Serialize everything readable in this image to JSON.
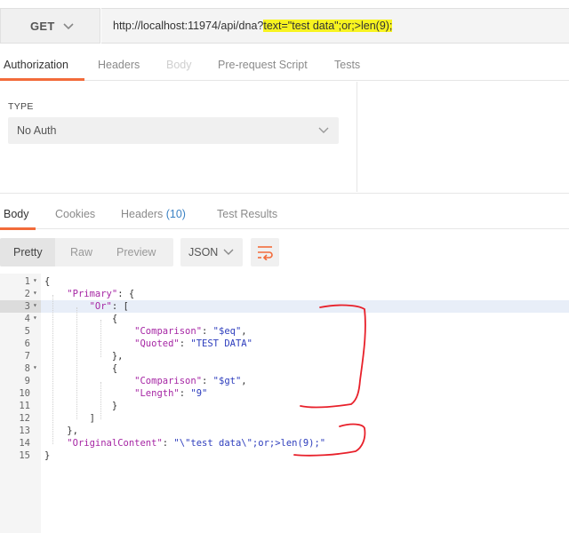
{
  "request": {
    "method": "GET",
    "url_prefix": "http://localhost:11974/api/dna?",
    "url_highlight": "text=\"test data\";or;>len(9);"
  },
  "request_tabs": [
    {
      "label": "Authorization"
    },
    {
      "label": "Headers"
    },
    {
      "label": "Body"
    },
    {
      "label": "Pre-request Script"
    },
    {
      "label": "Tests"
    }
  ],
  "auth": {
    "type_label": "TYPE",
    "selected": "No Auth"
  },
  "response_tabs": [
    {
      "label": "Body"
    },
    {
      "label": "Cookies"
    },
    {
      "label": "Headers",
      "badge": "(10)"
    },
    {
      "label": "Test Results"
    }
  ],
  "response_toolbar": {
    "views": [
      "Pretty",
      "Raw",
      "Preview"
    ],
    "format": "JSON"
  },
  "code_lines": [
    {
      "n": "1",
      "fold": "▾",
      "code": "{"
    },
    {
      "n": "2",
      "fold": "▾",
      "code": "    \"Primary\": {"
    },
    {
      "n": "3",
      "fold": "▾",
      "code": "        \"Or\": ["
    },
    {
      "n": "4",
      "fold": "▾",
      "code": "            {"
    },
    {
      "n": "5",
      "fold": "",
      "code": "                \"Comparison\": \"$eq\","
    },
    {
      "n": "6",
      "fold": "",
      "code": "                \"Quoted\": \"TEST DATA\""
    },
    {
      "n": "7",
      "fold": "",
      "code": "            },"
    },
    {
      "n": "8",
      "fold": "▾",
      "code": "            {"
    },
    {
      "n": "9",
      "fold": "",
      "code": "                \"Comparison\": \"$gt\","
    },
    {
      "n": "10",
      "fold": "",
      "code": "                \"Length\": \"9\""
    },
    {
      "n": "11",
      "fold": "",
      "code": "            }"
    },
    {
      "n": "12",
      "fold": "",
      "code": "        ]"
    },
    {
      "n": "13",
      "fold": "",
      "code": "    },"
    },
    {
      "n": "14",
      "fold": "",
      "code": "    \"OriginalContent\": \"\\\"test data\\\";or;>len(9);\""
    },
    {
      "n": "15",
      "fold": "",
      "code": "}"
    }
  ],
  "icons": {
    "method_chevron": "chevron-down-icon",
    "auth_chevron": "chevron-down-icon",
    "format_chevron": "chevron-down-icon",
    "wrap": "wrap-lines-icon"
  },
  "colors": {
    "accent": "#f26b3a",
    "url_highlight": "#f7f320",
    "json_key": "#a626a4",
    "json_string": "#2d3dbd",
    "annotation": "#e8202a"
  }
}
